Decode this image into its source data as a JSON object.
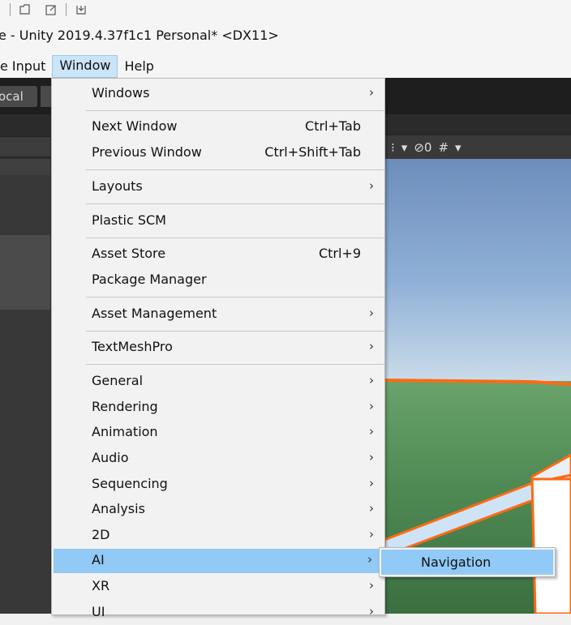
{
  "quick_access": {
    "icons": [
      "folder-icon",
      "edit-icon",
      "save-icon"
    ]
  },
  "window_title": "e - Unity 2019.4.37f1c1 Personal* <DX11>",
  "menubar": {
    "items": [
      {
        "label": "e Input"
      },
      {
        "label": "Window"
      },
      {
        "label": "Help"
      }
    ]
  },
  "editor": {
    "local_label": "ocal",
    "scene_toolbar": {
      "hidden_count": "0"
    }
  },
  "window_menu": {
    "items": [
      {
        "label": "Windows",
        "shortcut": "",
        "submenu": true
      },
      {
        "label": "Next Window",
        "shortcut": "Ctrl+Tab",
        "submenu": false
      },
      {
        "label": "Previous Window",
        "shortcut": "Ctrl+Shift+Tab",
        "submenu": false
      },
      {
        "label": "Layouts",
        "shortcut": "",
        "submenu": true
      },
      {
        "label": "Plastic SCM",
        "shortcut": "",
        "submenu": false
      },
      {
        "label": "Asset Store",
        "shortcut": "Ctrl+9",
        "submenu": false
      },
      {
        "label": "Package Manager",
        "shortcut": "",
        "submenu": false
      },
      {
        "label": "Asset Management",
        "shortcut": "",
        "submenu": true
      },
      {
        "label": "TextMeshPro",
        "shortcut": "",
        "submenu": true
      },
      {
        "label": "General",
        "shortcut": "",
        "submenu": true
      },
      {
        "label": "Rendering",
        "shortcut": "",
        "submenu": true
      },
      {
        "label": "Animation",
        "shortcut": "",
        "submenu": true
      },
      {
        "label": "Audio",
        "shortcut": "",
        "submenu": true
      },
      {
        "label": "Sequencing",
        "shortcut": "",
        "submenu": true
      },
      {
        "label": "Analysis",
        "shortcut": "",
        "submenu": true
      },
      {
        "label": "2D",
        "shortcut": "",
        "submenu": true
      },
      {
        "label": "AI",
        "shortcut": "",
        "submenu": true,
        "highlighted": true
      },
      {
        "label": "XR",
        "shortcut": "",
        "submenu": true
      },
      {
        "label": "UI",
        "shortcut": "",
        "submenu": true
      }
    ],
    "arrow_glyph": "›"
  },
  "ai_submenu": {
    "items": [
      {
        "label": "Navigation",
        "highlighted": true
      }
    ]
  },
  "colors": {
    "highlight": "#91c9f7",
    "menu_bg": "#f2f2f2",
    "active_menubar": "#cce4f7",
    "navmesh_outline": "#ff6a13"
  }
}
